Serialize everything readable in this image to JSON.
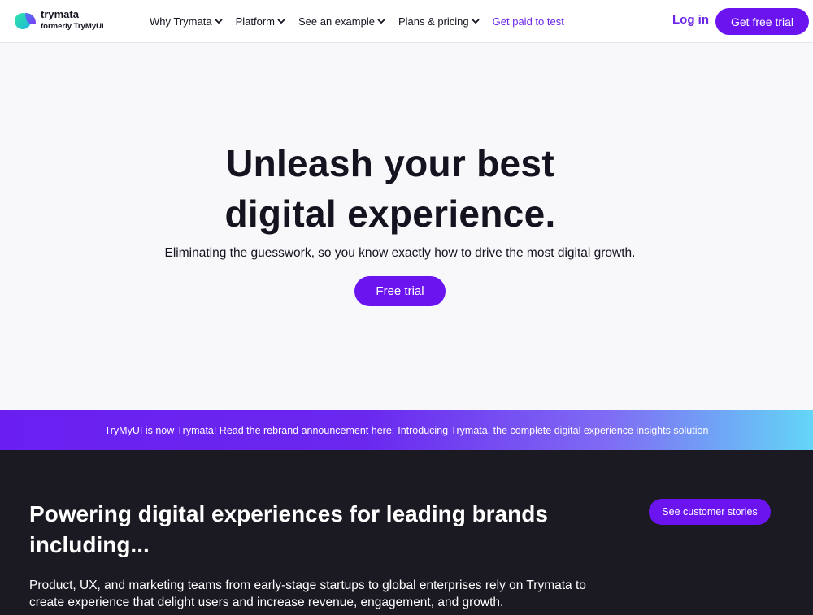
{
  "header": {
    "logo_name": "trymata",
    "logo_sub": "formerly TryMyUI",
    "nav": [
      {
        "label": "Why Trymata",
        "has_dropdown": true
      },
      {
        "label": "Platform",
        "has_dropdown": true
      },
      {
        "label": "See an example",
        "has_dropdown": true
      },
      {
        "label": "Plans & pricing",
        "has_dropdown": true
      },
      {
        "label": "Get paid to test",
        "has_dropdown": false
      }
    ],
    "login_label": "Log in",
    "cta_label": "Get free trial"
  },
  "hero": {
    "title_line1": "Unleash your best",
    "title_line2": "digital experience.",
    "subtitle": "Eliminating the guesswork, so you know exactly how to drive the most digital growth.",
    "cta_label": "Free trial"
  },
  "banner": {
    "text": "TryMyUI is now Trymata! Read the rebrand announcement here:",
    "link_text": "Introducing Trymata, the complete digital experience insights solution"
  },
  "brands_section": {
    "title": "Powering digital experiences for leading brands including...",
    "body": "Product, UX, and marketing teams from early-stage startups to global enterprises rely on Trymata to create experience that delight users and increase revenue, engagement, and growth.",
    "button_label": "See customer stories"
  },
  "colors": {
    "brand_purple": "#6b14f0",
    "dark_bg": "#1b1a22",
    "accent_text": "#6b24e8"
  }
}
